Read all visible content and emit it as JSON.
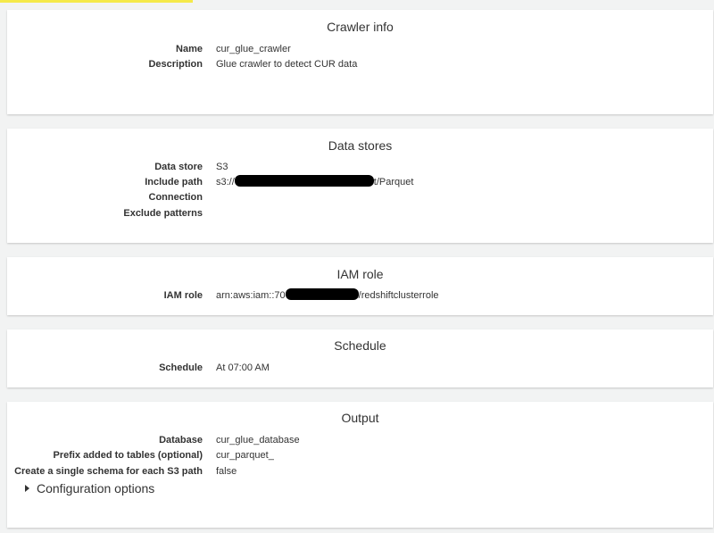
{
  "crawler_info": {
    "title": "Crawler info",
    "rows": [
      {
        "label": "Name",
        "value": "cur_glue_crawler"
      },
      {
        "label": "Description",
        "value": "Glue crawler to detect CUR data"
      }
    ]
  },
  "data_stores": {
    "title": "Data stores",
    "data_store_label": "Data store",
    "data_store_value": "S3",
    "include_path_label": "Include path",
    "include_path_prefix": "s3://",
    "include_path_suffix": "t/Parquet",
    "connection_label": "Connection",
    "connection_value": "",
    "exclude_patterns_label": "Exclude patterns",
    "exclude_patterns_value": ""
  },
  "iam_role": {
    "title": "IAM role",
    "label": "IAM role",
    "value_prefix": "arn:aws:iam::70",
    "value_suffix": "/redshiftclusterrole"
  },
  "schedule": {
    "title": "Schedule",
    "label": "Schedule",
    "value": "At 07:00 AM"
  },
  "output": {
    "title": "Output",
    "rows": [
      {
        "label": "Database",
        "value": "cur_glue_database"
      },
      {
        "label": "Prefix added to tables (optional)",
        "value": "cur_parquet_"
      },
      {
        "label": "Create a single schema for each S3 path",
        "value": "false"
      }
    ],
    "config_options_label": "Configuration options"
  },
  "colors": {
    "accent": "#f5e94a",
    "background": "#f2f3f3",
    "panel": "#ffffff",
    "redaction": "#000000"
  }
}
